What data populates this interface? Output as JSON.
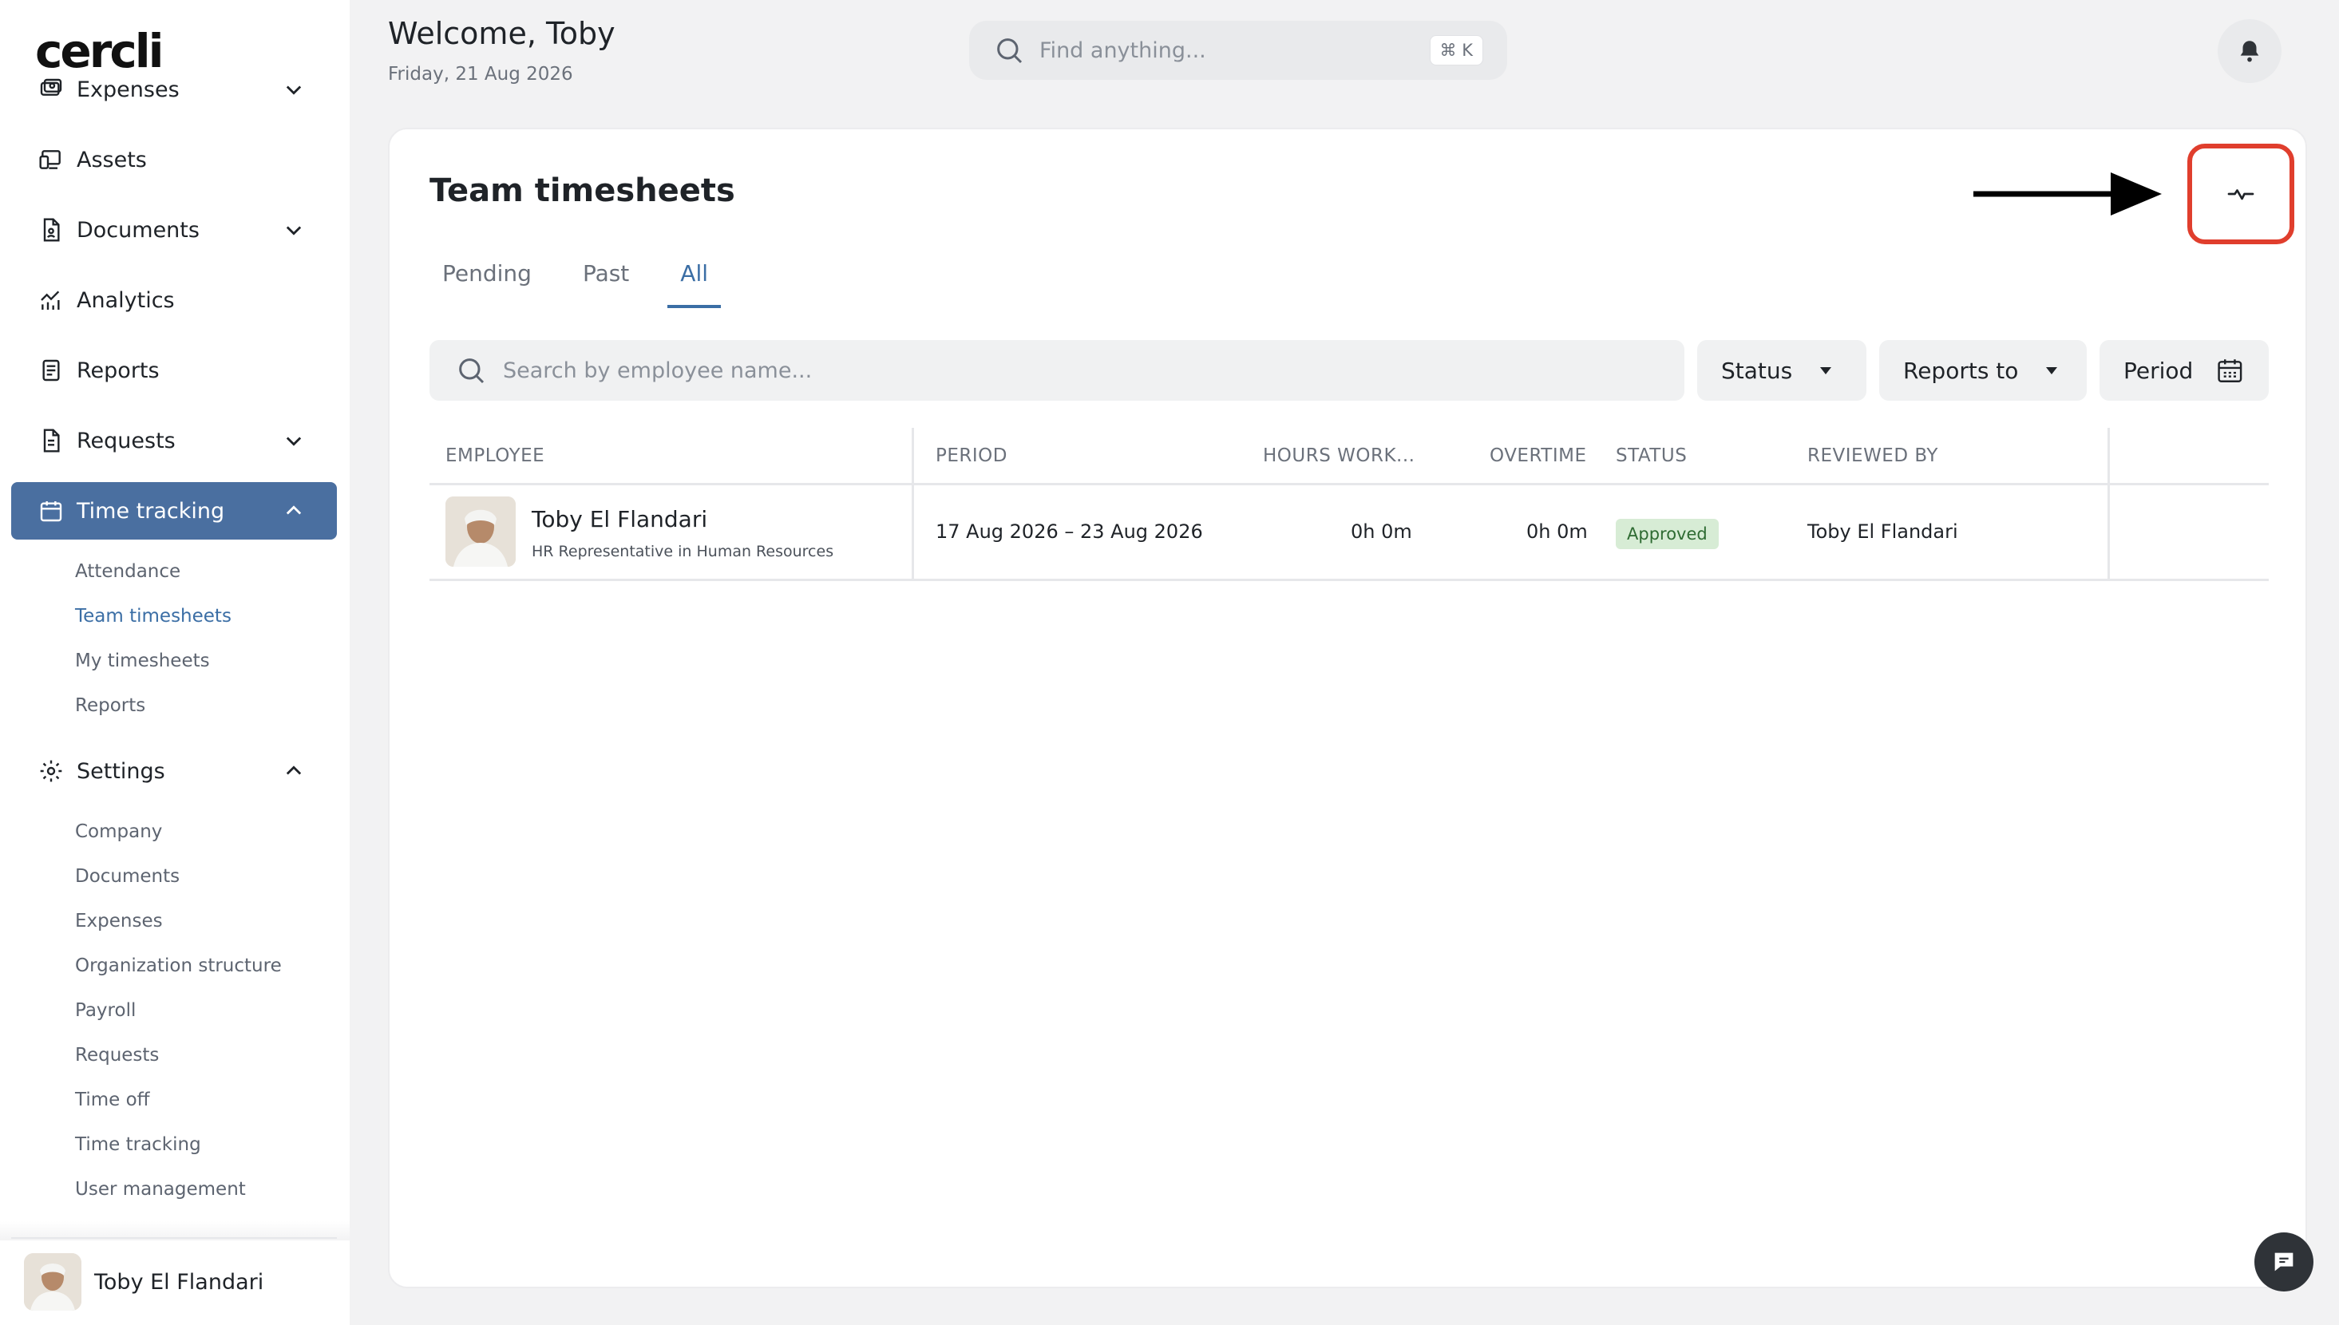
{
  "brand": {
    "logo": "cercli"
  },
  "header": {
    "welcome": "Welcome, Toby",
    "date": "Friday, 21 Aug 2026",
    "search_placeholder": "Find anything...",
    "shortcut": "⌘ K"
  },
  "sidebar": {
    "items": [
      {
        "label": "Expenses",
        "icon": "expenses-icon",
        "expandable": true,
        "expanded": false
      },
      {
        "label": "Assets",
        "icon": "assets-icon",
        "expandable": false
      },
      {
        "label": "Documents",
        "icon": "documents-icon",
        "expandable": true,
        "expanded": false
      },
      {
        "label": "Analytics",
        "icon": "analytics-icon",
        "expandable": false
      },
      {
        "label": "Reports",
        "icon": "reports-icon",
        "expandable": false
      },
      {
        "label": "Requests",
        "icon": "requests-icon",
        "expandable": true,
        "expanded": false
      },
      {
        "label": "Time tracking",
        "icon": "calendar-icon",
        "expandable": true,
        "expanded": true,
        "active": true
      },
      {
        "label": "Settings",
        "icon": "gear-icon",
        "expandable": true,
        "expanded": true
      }
    ],
    "time_tracking_sub": [
      "Attendance",
      "Team timesheets",
      "My timesheets",
      "Reports"
    ],
    "settings_sub": [
      "Company",
      "Documents",
      "Expenses",
      "Organization structure",
      "Payroll",
      "Requests",
      "Time off",
      "Time tracking",
      "User management"
    ],
    "user": {
      "name": "Toby El Flandari"
    }
  },
  "main": {
    "title": "Team timesheets",
    "tabs": [
      {
        "label": "Pending",
        "active": false
      },
      {
        "label": "Past",
        "active": false
      },
      {
        "label": "All",
        "active": true
      }
    ],
    "search_placeholder": "Search by employee name...",
    "filters": {
      "status": "Status",
      "reports_to": "Reports to",
      "period": "Period"
    },
    "table": {
      "columns": [
        "EMPLOYEE",
        "PERIOD",
        "HOURS WORK...",
        "OVERTIME",
        "STATUS",
        "REVIEWED BY"
      ],
      "rows": [
        {
          "employee_name": "Toby El Flandari",
          "employee_role": "HR Representative in Human Resources",
          "period": "17 Aug 2026 – 23 Aug 2026",
          "hours_worked": "0h 0m",
          "overtime": "0h 0m",
          "status": "Approved",
          "reviewed_by": "Toby El Flandari"
        }
      ]
    }
  },
  "colors": {
    "accent": "#3b6ea5",
    "active_nav_bg": "#4a6fa0",
    "approved_bg": "#d7ecd5",
    "approved_text": "#2e6b32",
    "annotation": "#e03e2d"
  }
}
